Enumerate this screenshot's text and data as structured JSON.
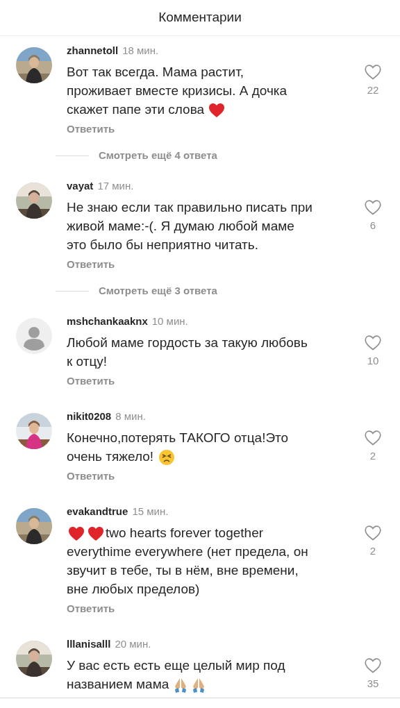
{
  "header": {
    "title": "Комментарии"
  },
  "comments": [
    {
      "avatar": {
        "kind": "picture"
      },
      "username": "zhannetoll",
      "time": "18 мин.",
      "lines": [
        [
          {
            "kind": "text",
            "text": "Вот так всегда. Мама растит,"
          }
        ],
        [
          {
            "kind": "text",
            "text": "проживает вместе кризисы. А дочка"
          }
        ],
        [
          {
            "kind": "text",
            "text": "скажет папе эти слова"
          },
          {
            "kind": "heart"
          }
        ]
      ],
      "likes": "22",
      "reply": "Ответить",
      "more": "Смотреть ещё 4 ответа"
    },
    {
      "avatar": {
        "kind": "picture"
      },
      "username": "vayat",
      "time": "17 мин.",
      "lines": [
        [
          {
            "kind": "text",
            "text": "Не знаю если так правильно писать при"
          }
        ],
        [
          {
            "kind": "text",
            "text": "живой маме:-(. Я думаю любой маме"
          }
        ],
        [
          {
            "kind": "text",
            "text": "это было бы неприятно читать."
          }
        ]
      ],
      "likes": "6",
      "reply": "Ответить",
      "more": "Смотреть ещё 3 ответа"
    },
    {
      "avatar": {
        "kind": "default"
      },
      "username": "mshchankaaknx",
      "time": "10 мин.",
      "lines": [
        [
          {
            "kind": "text",
            "text": "Любой маме гордость за такую любовь"
          }
        ],
        [
          {
            "kind": "text",
            "text": "к отцу!"
          }
        ]
      ],
      "likes": "10",
      "reply": "Ответить"
    },
    {
      "avatar": {
        "kind": "picture"
      },
      "username": "nikit0208",
      "time": "8 мин.",
      "lines": [
        [
          {
            "kind": "text",
            "text": "Конечно,потерять ТАКОГО отца!Это"
          }
        ],
        [
          {
            "kind": "text",
            "text": "очень тяжело!"
          },
          {
            "kind": "tired"
          }
        ]
      ],
      "likes": "2",
      "reply": "Ответить"
    },
    {
      "avatar": {
        "kind": "picture"
      },
      "username": "evakandtrue",
      "time": "15 мин.",
      "lines": [
        [
          {
            "kind": "heart"
          },
          {
            "kind": "heart"
          },
          {
            "kind": "text",
            "text": "two hearts forever together"
          }
        ],
        [
          {
            "kind": "text",
            "text": "everythime everywhere (нет предела, он"
          }
        ],
        [
          {
            "kind": "text",
            "text": "звучит в тебе, ты в нём, вне времени,"
          }
        ],
        [
          {
            "kind": "text",
            "text": "вне любых пределов)"
          }
        ]
      ],
      "likes": "2",
      "reply": "Ответить"
    },
    {
      "avatar": {
        "kind": "picture"
      },
      "username": "lllanisalll",
      "time": "20 мин.",
      "lines": [
        [
          {
            "kind": "text",
            "text": "У вас есть есть еще целый мир под"
          }
        ],
        [
          {
            "kind": "text",
            "text": "названием мама"
          },
          {
            "kind": "pray"
          },
          {
            "kind": "pray"
          }
        ]
      ],
      "likes": "35"
    }
  ]
}
